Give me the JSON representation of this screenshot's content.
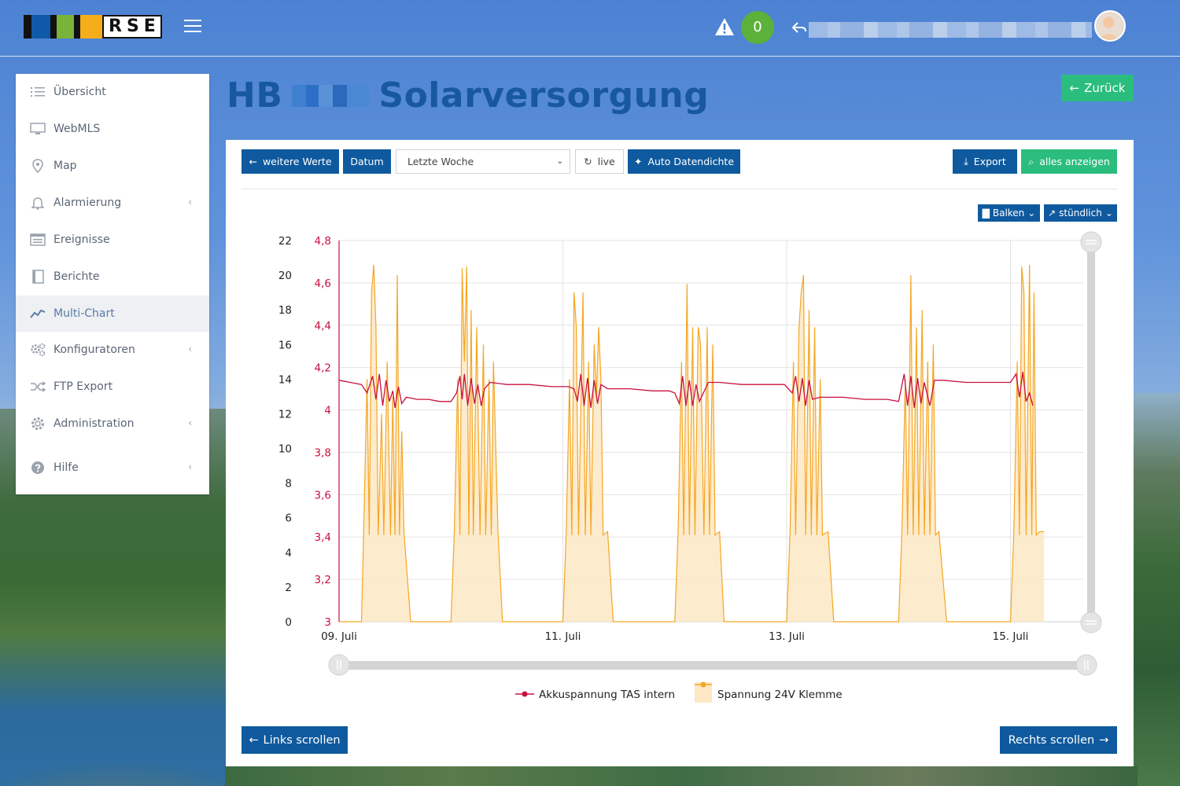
{
  "header": {
    "logo_text": "RSE",
    "alert_count": "0"
  },
  "sidebar": {
    "items": [
      {
        "label": "Übersicht",
        "icon": "list-icon",
        "chevron": false
      },
      {
        "label": "WebMLS",
        "icon": "monitor-icon",
        "chevron": false
      },
      {
        "label": "Map",
        "icon": "map-pin-icon",
        "chevron": false
      },
      {
        "label": "Alarmierung",
        "icon": "bell-icon",
        "chevron": true
      },
      {
        "label": "Ereignisse",
        "icon": "event-list-icon",
        "chevron": false
      },
      {
        "label": "Berichte",
        "icon": "book-icon",
        "chevron": false
      },
      {
        "label": "Multi-Chart",
        "icon": "line-chart-icon",
        "chevron": false,
        "active": true
      },
      {
        "label": "Konfiguratoren",
        "icon": "gears-icon",
        "chevron": true
      },
      {
        "label": "FTP Export",
        "icon": "shuffle-icon",
        "chevron": false
      },
      {
        "label": "Administration",
        "icon": "gear-icon",
        "chevron": true
      },
      {
        "label": "Hilfe",
        "icon": "question-circle-icon",
        "chevron": true
      }
    ]
  },
  "page": {
    "title_prefix": "HB",
    "title_suffix": "Solarversorgung",
    "back_label": "Zurück"
  },
  "toolbar": {
    "more_values": "weitere Werte",
    "date": "Datum",
    "range_selected": "Letzte Woche",
    "live": "live",
    "auto_density": "Auto Datendichte",
    "export": "Export",
    "show_all": "alles anzeigen",
    "chart_type": "Balken",
    "interval": "stündlich"
  },
  "footer": {
    "scroll_left": "Links scrollen",
    "scroll_right": "Rechts scrollen"
  },
  "colors": {
    "accent_blue": "#0f5a9e",
    "accent_green": "#2bbd7e",
    "series_battery": "#c8103f",
    "series_voltage": "#f5a623"
  },
  "chart_data": {
    "type": "line",
    "x_tick_labels": [
      "09. Juli",
      "11. Juli",
      "13. Juli",
      "15. Juli"
    ],
    "x_ticks_day": [
      9,
      11,
      13,
      15
    ],
    "x_range_day": [
      9.0,
      15.65
    ],
    "y_left": {
      "range": [
        0,
        22
      ],
      "ticks": [
        "0",
        "2",
        "4",
        "6",
        "8",
        "10",
        "12",
        "14",
        "16",
        "18",
        "20",
        "22"
      ]
    },
    "y_right": {
      "range": [
        3,
        4.8
      ],
      "ticks": [
        "3",
        "3,2",
        "3,4",
        "3,6",
        "3,8",
        "4",
        "4,2",
        "4,4",
        "4,6",
        "4,8"
      ]
    },
    "grid": true,
    "legend_position": "bottom",
    "series": [
      {
        "name": "Akkuspannung TAS intern",
        "axis": "right",
        "kind": "line",
        "points": [
          [
            9.0,
            4.14
          ],
          [
            9.1,
            4.13
          ],
          [
            9.2,
            4.12
          ],
          [
            9.25,
            4.08
          ],
          [
            9.3,
            4.16
          ],
          [
            9.33,
            4.05
          ],
          [
            9.36,
            4.17
          ],
          [
            9.39,
            4.02
          ],
          [
            9.42,
            4.14
          ],
          [
            9.45,
            4.04
          ],
          [
            9.48,
            4.09
          ],
          [
            9.5,
            4.01
          ],
          [
            9.53,
            4.11
          ],
          [
            9.56,
            4.03
          ],
          [
            9.6,
            4.06
          ],
          [
            9.7,
            4.05
          ],
          [
            9.8,
            4.05
          ],
          [
            9.9,
            4.04
          ],
          [
            10.0,
            4.04
          ],
          [
            10.05,
            4.08
          ],
          [
            10.08,
            4.16
          ],
          [
            10.1,
            4.05
          ],
          [
            10.12,
            4.17
          ],
          [
            10.15,
            4.02
          ],
          [
            10.18,
            4.15
          ],
          [
            10.21,
            4.03
          ],
          [
            10.24,
            4.12
          ],
          [
            10.27,
            4.02
          ],
          [
            10.3,
            4.1
          ],
          [
            10.35,
            4.13
          ],
          [
            10.5,
            4.12
          ],
          [
            10.7,
            4.12
          ],
          [
            10.9,
            4.11
          ],
          [
            11.05,
            4.11
          ],
          [
            11.1,
            4.1
          ],
          [
            11.13,
            4.04
          ],
          [
            11.16,
            4.17
          ],
          [
            11.19,
            4.02
          ],
          [
            11.22,
            4.15
          ],
          [
            11.25,
            4.01
          ],
          [
            11.28,
            4.14
          ],
          [
            11.31,
            4.03
          ],
          [
            11.34,
            4.12
          ],
          [
            11.4,
            4.1
          ],
          [
            11.6,
            4.1
          ],
          [
            11.8,
            4.09
          ],
          [
            11.95,
            4.09
          ],
          [
            12.0,
            4.08
          ],
          [
            12.04,
            4.03
          ],
          [
            12.07,
            4.16
          ],
          [
            12.1,
            4.02
          ],
          [
            12.13,
            4.14
          ],
          [
            12.16,
            4.02
          ],
          [
            12.19,
            4.12
          ],
          [
            12.22,
            4.04
          ],
          [
            12.3,
            4.13
          ],
          [
            12.4,
            4.13
          ],
          [
            12.6,
            4.12
          ],
          [
            12.8,
            4.12
          ],
          [
            12.98,
            4.12
          ],
          [
            13.05,
            4.08
          ],
          [
            13.08,
            4.16
          ],
          [
            13.11,
            4.04
          ],
          [
            13.14,
            4.15
          ],
          [
            13.17,
            4.02
          ],
          [
            13.2,
            4.14
          ],
          [
            13.23,
            4.05
          ],
          [
            13.3,
            4.06
          ],
          [
            13.5,
            4.06
          ],
          [
            13.7,
            4.05
          ],
          [
            13.9,
            4.05
          ],
          [
            14.0,
            4.04
          ],
          [
            14.05,
            4.17
          ],
          [
            14.08,
            4.02
          ],
          [
            14.11,
            4.16
          ],
          [
            14.14,
            4.01
          ],
          [
            14.17,
            4.15
          ],
          [
            14.2,
            4.03
          ],
          [
            14.23,
            4.13
          ],
          [
            14.28,
            4.02
          ],
          [
            14.32,
            4.14
          ],
          [
            14.4,
            4.14
          ],
          [
            14.6,
            4.13
          ],
          [
            14.8,
            4.13
          ],
          [
            15.0,
            4.13
          ],
          [
            15.05,
            4.17
          ],
          [
            15.08,
            4.06
          ],
          [
            15.11,
            4.18
          ],
          [
            15.14,
            4.04
          ],
          [
            15.17,
            4.08
          ],
          [
            15.2,
            4.02
          ]
        ]
      },
      {
        "name": "Spannung 24V Klemme",
        "axis": "left",
        "kind": "area",
        "points": [
          [
            9.0,
            0
          ],
          [
            9.2,
            0
          ],
          [
            9.22,
            5.2
          ],
          [
            9.25,
            14
          ],
          [
            9.27,
            5
          ],
          [
            9.29,
            19
          ],
          [
            9.31,
            20.6
          ],
          [
            9.33,
            17
          ],
          [
            9.35,
            5
          ],
          [
            9.38,
            12
          ],
          [
            9.4,
            5
          ],
          [
            9.43,
            15
          ],
          [
            9.46,
            5
          ],
          [
            9.48,
            13
          ],
          [
            9.5,
            5
          ],
          [
            9.52,
            20
          ],
          [
            9.54,
            5
          ],
          [
            9.56,
            11
          ],
          [
            9.58,
            5.2
          ],
          [
            9.64,
            0
          ],
          [
            10.0,
            0
          ],
          [
            10.03,
            5.2
          ],
          [
            10.06,
            14
          ],
          [
            10.08,
            5
          ],
          [
            10.1,
            20.4
          ],
          [
            10.12,
            15
          ],
          [
            10.14,
            20.5
          ],
          [
            10.16,
            5
          ],
          [
            10.18,
            18
          ],
          [
            10.2,
            5
          ],
          [
            10.23,
            17
          ],
          [
            10.26,
            5
          ],
          [
            10.29,
            16
          ],
          [
            10.31,
            5
          ],
          [
            10.34,
            14
          ],
          [
            10.36,
            5
          ],
          [
            10.38,
            15
          ],
          [
            10.42,
            5.2
          ],
          [
            10.46,
            0
          ],
          [
            10.8,
            0
          ],
          [
            11.0,
            0
          ],
          [
            11.03,
            5.2
          ],
          [
            11.06,
            14
          ],
          [
            11.08,
            5
          ],
          [
            11.1,
            19
          ],
          [
            11.12,
            17
          ],
          [
            11.14,
            5
          ],
          [
            11.18,
            19
          ],
          [
            11.2,
            5
          ],
          [
            11.23,
            15
          ],
          [
            11.25,
            5
          ],
          [
            11.28,
            16
          ],
          [
            11.3,
            13
          ],
          [
            11.32,
            17
          ],
          [
            11.34,
            14
          ],
          [
            11.36,
            5
          ],
          [
            11.4,
            5.2
          ],
          [
            11.45,
            0
          ],
          [
            12.0,
            0
          ],
          [
            12.03,
            5.2
          ],
          [
            12.06,
            15
          ],
          [
            12.08,
            5
          ],
          [
            12.11,
            19.5
          ],
          [
            12.13,
            5
          ],
          [
            12.16,
            17
          ],
          [
            12.18,
            5
          ],
          [
            12.21,
            17
          ],
          [
            12.23,
            16
          ],
          [
            12.26,
            5
          ],
          [
            12.29,
            17
          ],
          [
            12.31,
            5
          ],
          [
            12.34,
            16
          ],
          [
            12.36,
            5
          ],
          [
            12.4,
            5.2
          ],
          [
            12.44,
            0
          ],
          [
            13.0,
            0
          ],
          [
            13.03,
            5.2
          ],
          [
            13.06,
            15
          ],
          [
            13.08,
            5
          ],
          [
            13.11,
            17
          ],
          [
            13.13,
            19
          ],
          [
            13.15,
            20
          ],
          [
            13.17,
            5
          ],
          [
            13.2,
            18
          ],
          [
            13.22,
            5
          ],
          [
            13.25,
            17
          ],
          [
            13.27,
            5
          ],
          [
            13.3,
            14
          ],
          [
            13.32,
            5
          ],
          [
            13.37,
            5.2
          ],
          [
            13.42,
            0
          ],
          [
            13.9,
            0
          ],
          [
            14.0,
            0
          ],
          [
            14.03,
            5.2
          ],
          [
            14.06,
            14
          ],
          [
            14.08,
            5
          ],
          [
            14.11,
            20
          ],
          [
            14.13,
            5
          ],
          [
            14.16,
            17
          ],
          [
            14.18,
            5
          ],
          [
            14.21,
            18
          ],
          [
            14.23,
            5
          ],
          [
            14.26,
            15
          ],
          [
            14.28,
            5
          ],
          [
            14.31,
            16
          ],
          [
            14.33,
            5
          ],
          [
            14.36,
            5.2
          ],
          [
            14.43,
            0
          ],
          [
            15.0,
            0
          ],
          [
            15.03,
            5.2
          ],
          [
            15.06,
            15
          ],
          [
            15.08,
            5
          ],
          [
            15.1,
            20.5
          ],
          [
            15.12,
            19
          ],
          [
            15.14,
            5
          ],
          [
            15.17,
            20.6
          ],
          [
            15.19,
            5
          ],
          [
            15.21,
            19
          ],
          [
            15.23,
            5
          ],
          [
            15.26,
            5.2
          ],
          [
            15.3,
            5.2
          ]
        ]
      }
    ]
  }
}
